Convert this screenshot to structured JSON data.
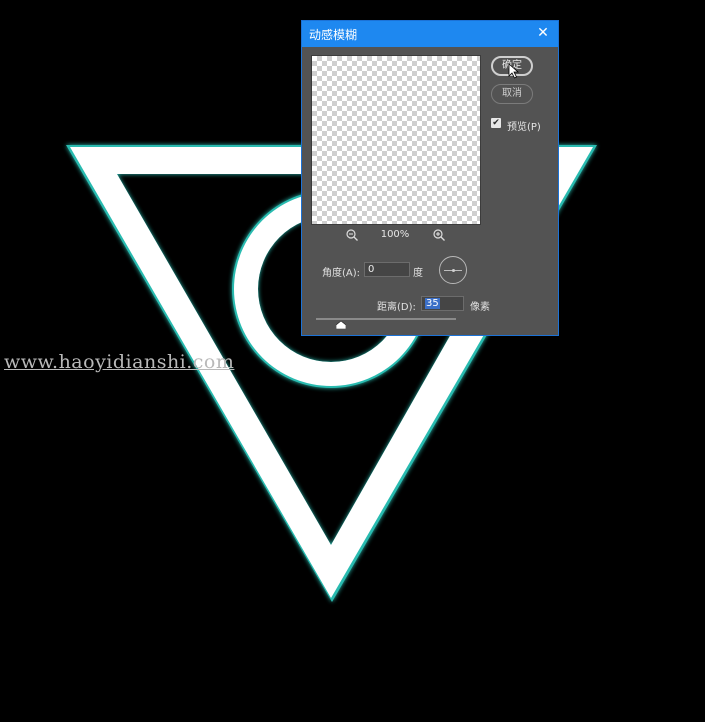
{
  "canvas": {
    "background_color": "#000000",
    "shape_color": "#ffffff",
    "glow_color": "#2fd0c4"
  },
  "watermark": {
    "text": "www.haoyidianshi.com"
  },
  "dialog": {
    "title": "动感模糊",
    "close_icon": "close-icon",
    "preview_zoom": "100%",
    "ok_label": "确定",
    "cancel_label": "取消",
    "preview_checkbox": {
      "label": "预览(P)",
      "checked": true
    },
    "angle": {
      "label": "角度(A):",
      "value": "0",
      "unit": "度"
    },
    "distance": {
      "label": "距离(D):",
      "value": "35",
      "unit": "像素"
    },
    "slider_fraction": 0.18,
    "accent_color": "#1e88f0",
    "body_color": "#535353"
  }
}
